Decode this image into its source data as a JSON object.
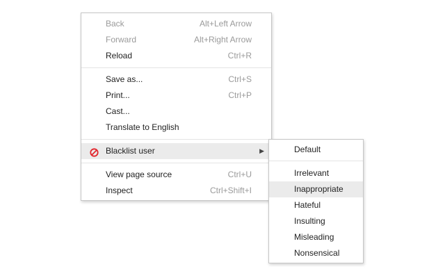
{
  "context_menu": {
    "items": [
      {
        "label": "Back",
        "shortcut": "Alt+Left Arrow",
        "disabled": true
      },
      {
        "label": "Forward",
        "shortcut": "Alt+Right Arrow",
        "disabled": true
      },
      {
        "label": "Reload",
        "shortcut": "Ctrl+R",
        "disabled": false
      },
      {
        "label": "Save as...",
        "shortcut": "Ctrl+S",
        "disabled": false
      },
      {
        "label": "Print...",
        "shortcut": "Ctrl+P",
        "disabled": false
      },
      {
        "label": "Cast...",
        "shortcut": "",
        "disabled": false
      },
      {
        "label": "Translate to English",
        "shortcut": "",
        "disabled": false
      },
      {
        "label": "Blacklist user",
        "shortcut": "",
        "icon": "block-icon",
        "has_submenu": true,
        "highlighted": true
      },
      {
        "label": "View page source",
        "shortcut": "Ctrl+U",
        "disabled": false
      },
      {
        "label": "Inspect",
        "shortcut": "Ctrl+Shift+I",
        "disabled": false
      }
    ]
  },
  "submenu": {
    "items": [
      {
        "label": "Default"
      },
      {
        "label": "Irrelevant"
      },
      {
        "label": "Inappropriate",
        "highlighted": true
      },
      {
        "label": "Hateful"
      },
      {
        "label": "Insulting"
      },
      {
        "label": "Misleading"
      },
      {
        "label": "Nonsensical"
      }
    ]
  },
  "colors": {
    "block_icon": "#e2262d",
    "highlight": "#ebebeb",
    "disabled_text": "#9a9a9a"
  },
  "icons": {
    "blacklist": "block-icon",
    "submenu_arrow": "chevron-right-icon"
  }
}
